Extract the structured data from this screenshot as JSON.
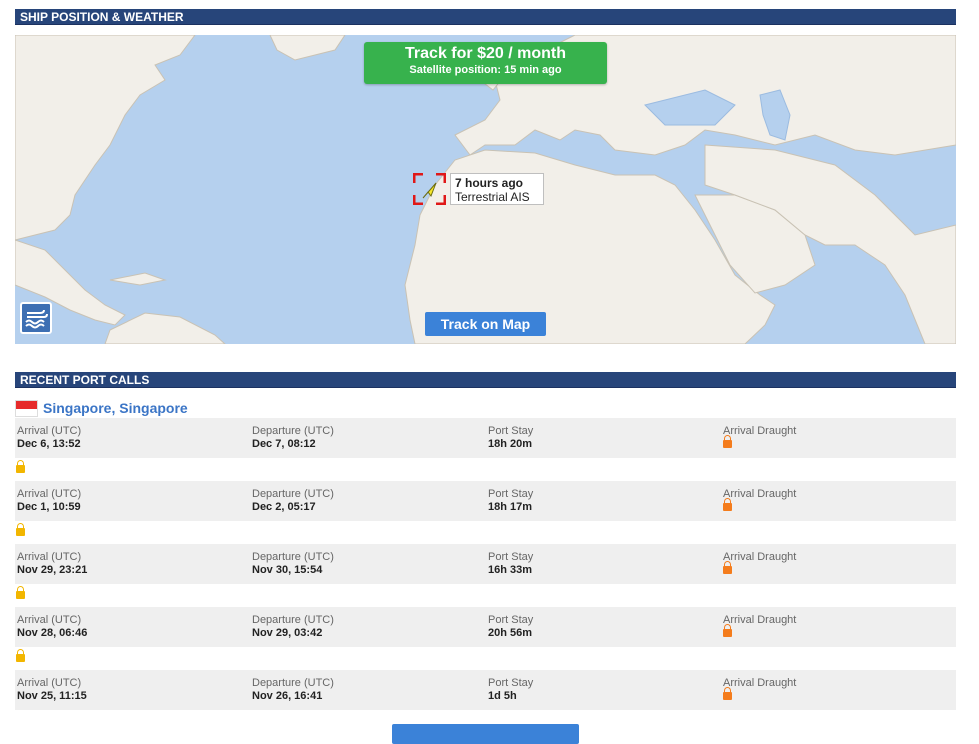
{
  "position_section": {
    "title": "SHIP POSITION & WEATHER",
    "promo_title": "Track for $20 / month",
    "promo_subtitle": "Satellite position: 15 min ago",
    "tooltip_time": "7 hours ago",
    "tooltip_source": "Terrestrial AIS",
    "track_button": "Track on Map",
    "weather_icon": "wind-waves-icon"
  },
  "port_calls_section": {
    "title": "RECENT PORT CALLS",
    "port_name": "Singapore, Singapore",
    "flag": "singapore-flag",
    "labels": {
      "arrival": "Arrival (UTC)",
      "departure": "Departure (UTC)",
      "stay": "Port Stay",
      "draught": "Arrival Draught"
    },
    "calls": [
      {
        "arrival": "Dec 6, 13:52",
        "departure": "Dec 7, 08:12",
        "stay": "18h 20m"
      },
      {
        "arrival": "Dec 1, 10:59",
        "departure": "Dec 2, 05:17",
        "stay": "18h 17m"
      },
      {
        "arrival": "Nov 29, 23:21",
        "departure": "Nov 30, 15:54",
        "stay": "16h 33m"
      },
      {
        "arrival": "Nov 28, 06:46",
        "departure": "Nov 29, 03:42",
        "stay": "20h 56m"
      },
      {
        "arrival": "Nov 25, 11:15",
        "departure": "Nov 26, 16:41",
        "stay": "1d 5h"
      }
    ]
  },
  "colors": {
    "header_bg": "#27457a",
    "promo_green": "#37b24d",
    "button_blue": "#3b82d8",
    "lock_orange": "#f47c1c",
    "lock_yellow": "#f2b600"
  }
}
